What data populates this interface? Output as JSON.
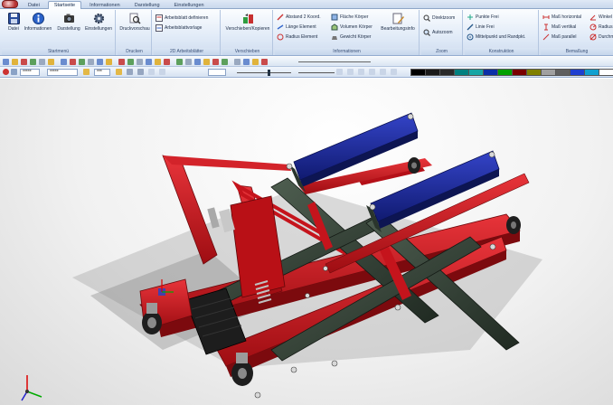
{
  "tabs": [
    {
      "label": "Datei",
      "active": false
    },
    {
      "label": "Startseite",
      "active": true
    },
    {
      "label": "Informationen",
      "active": false
    },
    {
      "label": "Darstellung",
      "active": false
    },
    {
      "label": "Einstellungen",
      "active": false
    }
  ],
  "ribbon": {
    "startmenu": {
      "label": "Startmenü",
      "buttons": [
        "Datei",
        "Informationen",
        "Darstellung",
        "Einstellungen"
      ]
    },
    "drucken": {
      "label": "Drucken",
      "buttons": [
        "Druckvorschau"
      ]
    },
    "arbeitsblatt": {
      "label": "2D Arbeitsblätter",
      "buttons": [
        "Arbeitsblatt definieren",
        "Arbeitsblattvorlage"
      ]
    },
    "verschieben": {
      "label": "Verschieben",
      "buttons": [
        "Verschieben/Kopieren"
      ]
    },
    "informationen": {
      "label": "Informationen",
      "col1": [
        "Abstand 2 Koord.",
        "Länge Element",
        "Radius Element"
      ],
      "col2": [
        "Fläche Körper",
        "Volumen Körper",
        "Gewicht Körper"
      ],
      "col3": [
        "Bearbeitungsinfo"
      ]
    },
    "zoom": {
      "label": "Zoom",
      "buttons": [
        "Direktzoom",
        "Autozoom"
      ]
    },
    "konstruktion": {
      "label": "Konstruktion",
      "buttons": [
        "Punkte Frei",
        "Linie Frei",
        "Mittelpunkt und Randpkt."
      ]
    },
    "bemassung": {
      "label": "Bemaßung",
      "col1": [
        "Maß horizontal",
        "Maß vertikal",
        "Maß parallel"
      ],
      "col2": [
        "Winkel",
        "Radius",
        "Durchm."
      ]
    }
  },
  "toolbar2": {
    "combo1": "*****",
    "combo2": "*****",
    "combo3": "***",
    "swatches": [
      "#000000",
      "#1a1a1a",
      "#2a2a2a",
      "#008080",
      "#16a5a5",
      "#0b2fa8",
      "#00a000",
      "#7a0000",
      "#808000",
      "#a0a0a0",
      "#5f5f5f",
      "#1e3fd0",
      "#10a0d0",
      "#ffffff"
    ]
  },
  "colors": {
    "frame_red": "#c5141c",
    "frame_red_dark": "#7c0a0e",
    "arm_green": "#2e3b30",
    "pad_blue": "#1b2aa0"
  },
  "icons": {
    "save": "floppy-disk-icon",
    "info": "info-icon",
    "camera": "camera-icon",
    "settings": "gear-icon",
    "print": "magnifier-icon"
  }
}
